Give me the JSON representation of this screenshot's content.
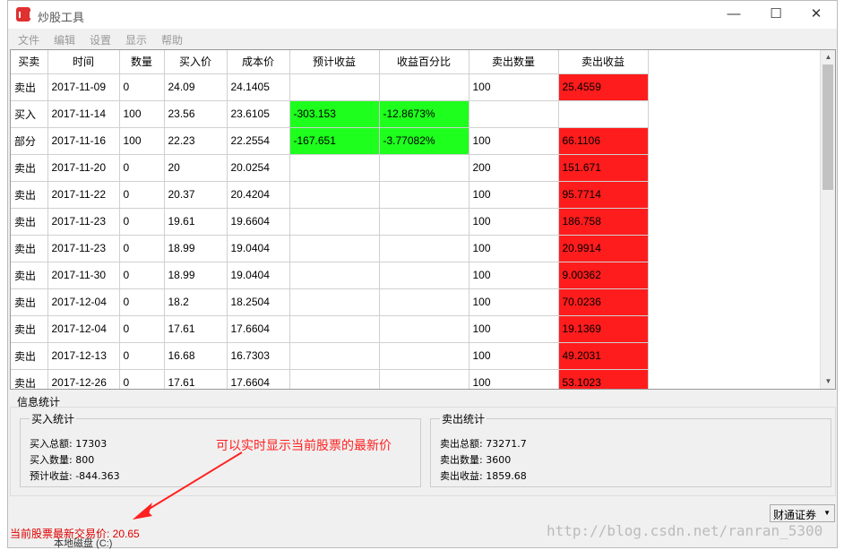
{
  "window": {
    "title": "炒股工具"
  },
  "menu": [
    "文件",
    "编辑",
    "设置",
    "显示",
    "帮助"
  ],
  "table": {
    "headers": [
      "买卖",
      "时间",
      "数量",
      "买入价",
      "成本价",
      "预计收益",
      "收益百分比",
      "卖出数量",
      "卖出收益"
    ],
    "rows": [
      [
        "卖出",
        "2017-11-09",
        "0",
        "24.09",
        "24.1405",
        "",
        "",
        "100",
        "25.4559"
      ],
      [
        "买入",
        "2017-11-14",
        "100",
        "23.56",
        "23.6105",
        "-303.153",
        "-12.8673%",
        "",
        ""
      ],
      [
        "部分",
        "2017-11-16",
        "100",
        "22.23",
        "22.2554",
        "-167.651",
        "-3.77082%",
        "100",
        "66.1106"
      ],
      [
        "卖出",
        "2017-11-20",
        "0",
        "20",
        "20.0254",
        "",
        "",
        "200",
        "151.671"
      ],
      [
        "卖出",
        "2017-11-22",
        "0",
        "20.37",
        "20.4204",
        "",
        "",
        "100",
        "95.7714"
      ],
      [
        "卖出",
        "2017-11-23",
        "0",
        "19.61",
        "19.6604",
        "",
        "",
        "100",
        "186.758"
      ],
      [
        "卖出",
        "2017-11-23",
        "0",
        "18.99",
        "19.0404",
        "",
        "",
        "100",
        "20.9914"
      ],
      [
        "卖出",
        "2017-11-30",
        "0",
        "18.99",
        "19.0404",
        "",
        "",
        "100",
        "9.00362"
      ],
      [
        "卖出",
        "2017-12-04",
        "0",
        "18.2",
        "18.2504",
        "",
        "",
        "100",
        "70.0236"
      ],
      [
        "卖出",
        "2017-12-04",
        "0",
        "17.61",
        "17.6604",
        "",
        "",
        "100",
        "19.1369"
      ],
      [
        "卖出",
        "2017-12-13",
        "0",
        "16.68",
        "16.7303",
        "",
        "",
        "100",
        "49.2031"
      ],
      [
        "卖出",
        "2017-12-26",
        "0",
        "17.61",
        "17.6604",
        "",
        "",
        "100",
        "53.1023"
      ]
    ]
  },
  "info": {
    "title": "信息统计",
    "buy": {
      "title": "买入统计",
      "lines": [
        "买入总额: 17303",
        "买入数量: 800",
        "预计收益: -844.363"
      ]
    },
    "sell": {
      "title": "卖出统计",
      "lines": [
        "卖出总额: 73271.7",
        "卖出数量: 3600",
        "卖出收益: 1859.68"
      ]
    }
  },
  "annotation": "可以实时显示当前股票的最新价",
  "status": {
    "price_text": "当前股票最新交易价: 20.65",
    "broker": "财通证券"
  },
  "watermark": "http://blog.csdn.net/ranran_5300",
  "background": {
    "drive_label": "本地磁盘 (C:)"
  },
  "colors": {
    "green": "#1eff1e",
    "red": "#ff1c1c",
    "annotation": "#ff2020"
  }
}
